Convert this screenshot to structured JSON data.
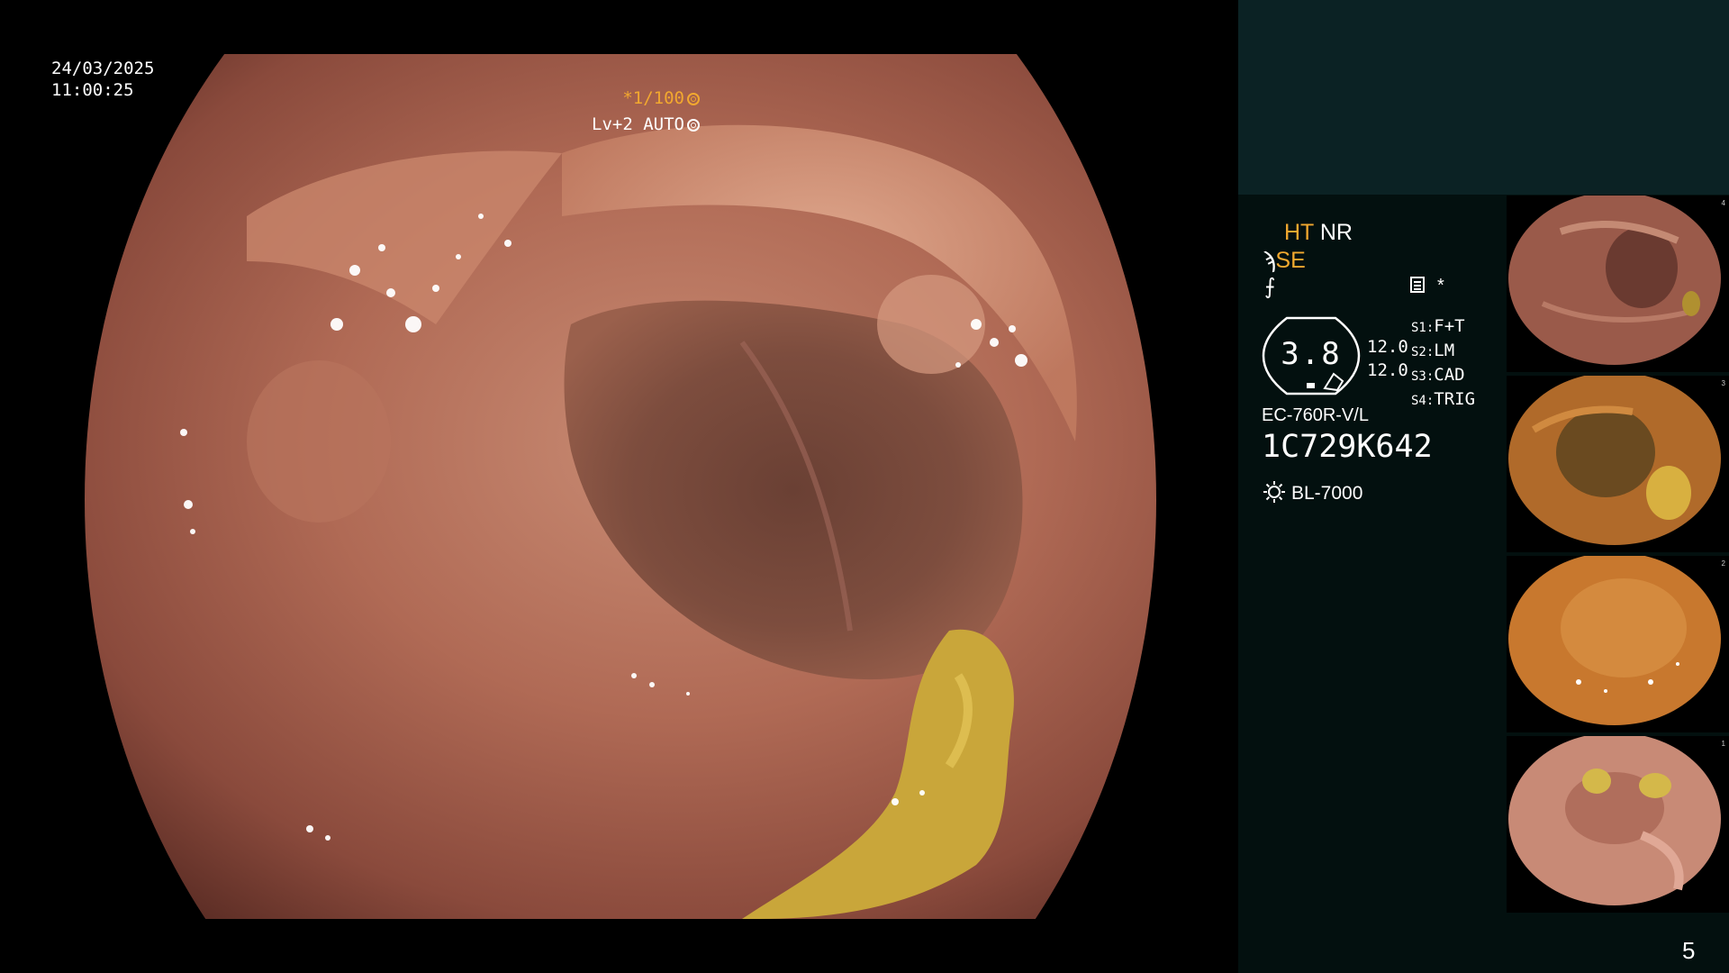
{
  "osd": {
    "date": "24/03/2025",
    "time": "11:00:25",
    "shutter": "*1/100",
    "level": "Lv+2 AUTO"
  },
  "panel": {
    "ht": "HT",
    "nr": "NR",
    "se_prefix": "ϡ",
    "se": "SE",
    "f_icon": "⨍",
    "star": "*",
    "zoom": "3.8",
    "param_1": "12.0",
    "param_2": "12.0",
    "switches": [
      {
        "key": "S1:",
        "value": "F+T"
      },
      {
        "key": "S2:",
        "value": "LM"
      },
      {
        "key": "S3:",
        "value": "CAD"
      },
      {
        "key": "S4:",
        "value": "TRIG"
      }
    ],
    "model": "EC-760R-V/L",
    "serial": "1C729K642",
    "light_source": "BL-7000"
  },
  "thumbnails": [
    {
      "index": "4"
    },
    {
      "index": "3"
    },
    {
      "index": "2"
    },
    {
      "index": "1"
    }
  ],
  "page_number": "5",
  "colors": {
    "accent_orange": "#f2a82f",
    "panel_dark": "#03100f",
    "panel_top": "#0b2224"
  }
}
